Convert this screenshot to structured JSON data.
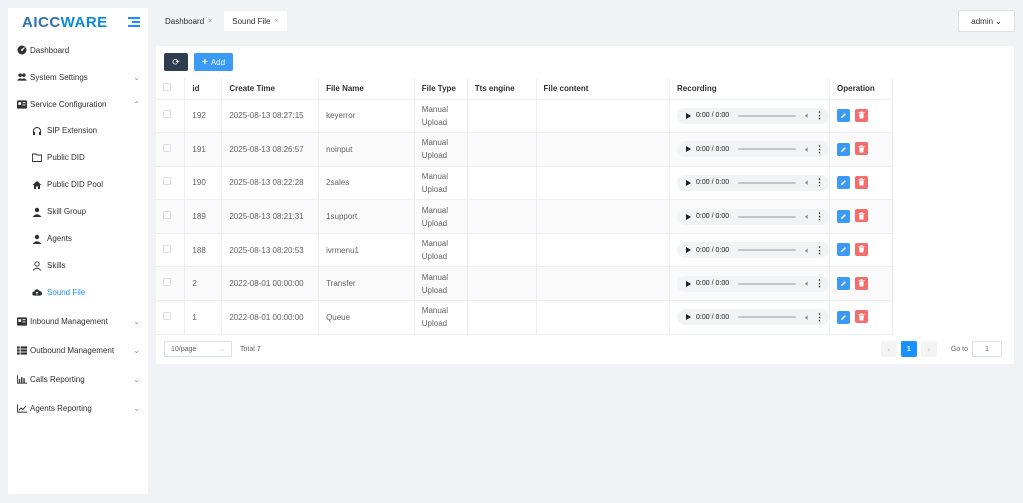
{
  "sidebar": {
    "logo_part1": "AICC",
    "logo_part2": "WARE",
    "items": [
      {
        "label": "Dashboard",
        "icon": "dashboard-icon",
        "chevron": ""
      },
      {
        "label": "System Settings",
        "icon": "users-icon",
        "chevron": "⌄"
      },
      {
        "label": "Service Configuration",
        "icon": "id-card-icon",
        "chevron": "⌃"
      }
    ],
    "sub_items": [
      {
        "label": "SIP Extension",
        "icon": "headset-icon"
      },
      {
        "label": "Public DID",
        "icon": "folder-icon"
      },
      {
        "label": "Public DID Pool",
        "icon": "home-icon"
      },
      {
        "label": "Skill Group",
        "icon": "user-tie-icon"
      },
      {
        "label": "Agents",
        "icon": "user-icon"
      },
      {
        "label": "Skills",
        "icon": "user-outline-icon"
      },
      {
        "label": "Sound File",
        "icon": "cloud-upload-icon"
      }
    ],
    "bottom_items": [
      {
        "label": "Inbound Management",
        "icon": "id-card-icon",
        "chevron": "⌄"
      },
      {
        "label": "Outbound Management",
        "icon": "list-icon",
        "chevron": "⌄"
      },
      {
        "label": "Calls Reporting",
        "icon": "bar-chart-icon",
        "chevron": "⌄"
      },
      {
        "label": "Agents Reporting",
        "icon": "line-chart-icon",
        "chevron": "⌄"
      }
    ]
  },
  "tabs": [
    {
      "label": "Dashboard",
      "close": "×"
    },
    {
      "label": "Sound File",
      "close": "×"
    }
  ],
  "user": {
    "name": "admin",
    "chevron": "⌄"
  },
  "toolbar": {
    "add_label": "Add",
    "add_plus": "+",
    "refresh_glyph": "⟳"
  },
  "table": {
    "headers": [
      "",
      "id",
      "Create Time",
      "File Name",
      "File Type",
      "Tts engine",
      "File content",
      "Recording",
      "Operation"
    ],
    "rows": [
      {
        "id": "192",
        "time": "2025-08-13 08:27:15",
        "name": "keyerror",
        "type1": "Manual",
        "type2": "Upload",
        "tts": "",
        "content": "",
        "audio": "0:00 / 0:00"
      },
      {
        "id": "191",
        "time": "2025-08-13 08:26:57",
        "name": "noinput",
        "type1": "Manual",
        "type2": "Upload",
        "tts": "",
        "content": "",
        "audio": "0:00 / 0:00"
      },
      {
        "id": "190",
        "time": "2025-08-13 08:22:28",
        "name": "2sales",
        "type1": "Manual",
        "type2": "Upload",
        "tts": "",
        "content": "",
        "audio": "0:00 / 0:00"
      },
      {
        "id": "189",
        "time": "2025-08-13 08:21:31",
        "name": "1support",
        "type1": "Manual",
        "type2": "Upload",
        "tts": "",
        "content": "",
        "audio": "0:00 / 0:00"
      },
      {
        "id": "188",
        "time": "2025-08-13 08:20:53",
        "name": "ivrmenu1",
        "type1": "Manual",
        "type2": "Upload",
        "tts": "",
        "content": "",
        "audio": "0:00 / 0:00"
      },
      {
        "id": "2",
        "time": "2022-08-01 00:00:00",
        "name": "Transfer",
        "type1": "Manual",
        "type2": "Upload",
        "tts": "",
        "content": "",
        "audio": "0:00 / 0:00"
      },
      {
        "id": "1",
        "time": "2022-08-01 00:00:00",
        "name": "Queue",
        "type1": "Manual",
        "type2": "Upload",
        "tts": "",
        "content": "",
        "audio": "0:00 / 0:00"
      }
    ]
  },
  "pagination": {
    "page_size": "10/page",
    "total": "Total 7",
    "current_page": "1",
    "goto_label": "Go to",
    "goto_value": "1"
  },
  "colors": {
    "accent": "#1890ff",
    "danger": "#f56c6c",
    "dark": "#2f3e4e"
  }
}
